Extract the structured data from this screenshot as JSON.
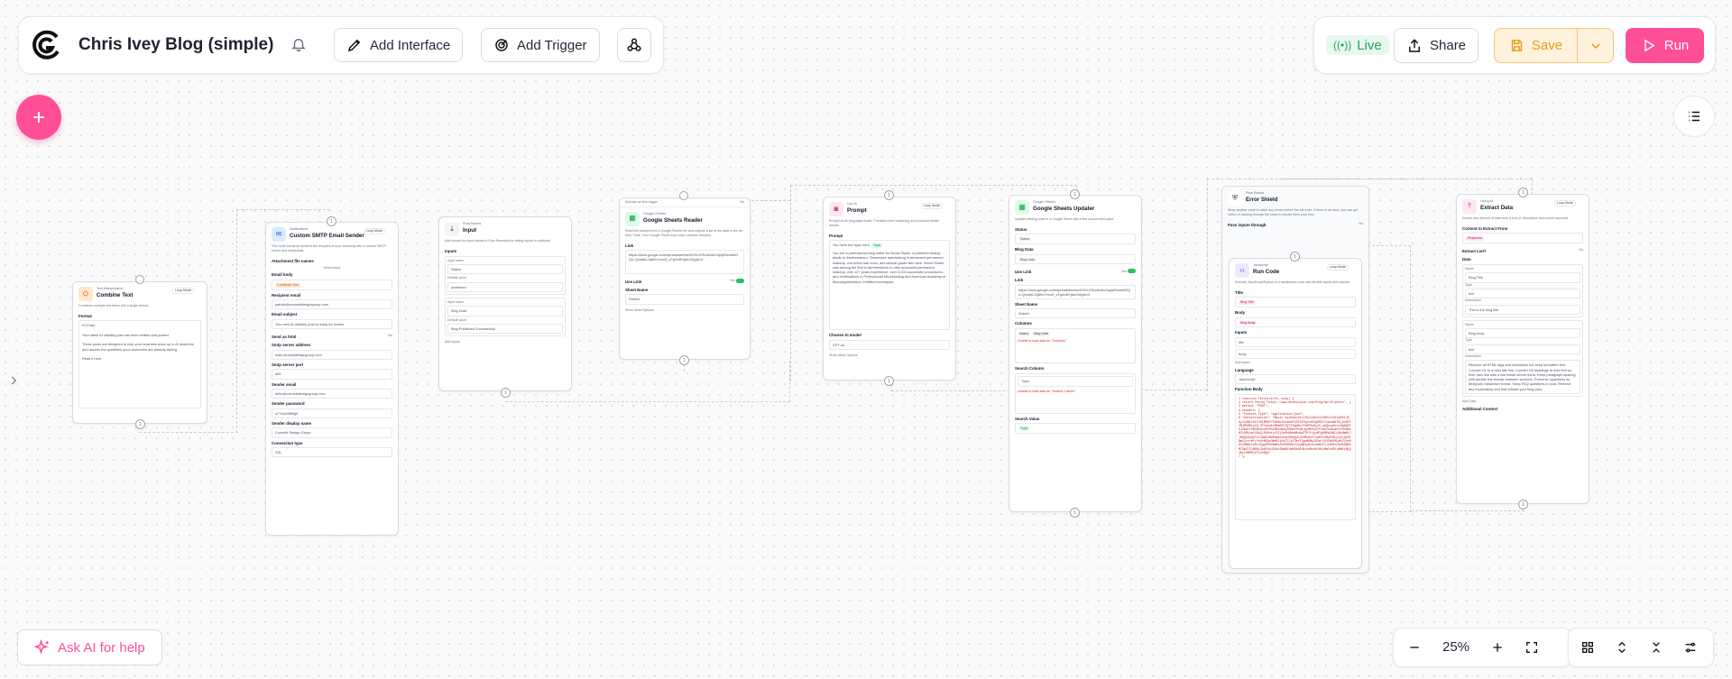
{
  "topbar": {
    "title": "Chris Ivey Blog (simple)",
    "add_interface": "Add Interface",
    "add_trigger": "Add Trigger",
    "live": "Live",
    "share": "Share",
    "save": "Save",
    "run": "Run"
  },
  "bottom": {
    "ask_ai": "Ask AI for help",
    "zoom": "25%"
  },
  "colors": {
    "accent": "#ff4f96",
    "save_bg": "#fff2dc",
    "save_text": "#e59b14",
    "live_green": "#22c55e"
  },
  "nodes": {
    "combine": {
      "category": "Text Manipulation",
      "mode": "Loop Mode",
      "title": "Combine Text",
      "desc": "Combines multiple text items into a single format",
      "format_label": "Format",
      "format_value": "Hi Chris,\n\nYour latest AI visibility post has been written and posted.\n\nThese posts are designed to help your business show up in AI searches and answer the questions your customers are already asking.\n\nRead it here:"
    },
    "smtp": {
      "category": "Notifications",
      "mode": "Loop Mode",
      "title": "Custom SMTP Email Sender",
      "desc": "This node sends an email to the recipient of your choosing with a custom SMTP server and credentials.",
      "attachment_label": "Attachment file names",
      "select_input": "Select input",
      "email_body_label": "Email body",
      "email_body_tag": "Combined Text",
      "recipient_label": "Recipient email",
      "recipient_value": "patrick@connektdesigngroup.com",
      "subject_label": "Email subject",
      "subject_value": "Your new AI visibility post is ready for review",
      "send_html_label": "Send as html",
      "send_html_value": "No",
      "server_label": "Smtp server address",
      "server_value": "mail.connektdesigngroup.com",
      "port_label": "Smtp server port",
      "port_value": "465",
      "sender_email_label": "Sender email",
      "sender_email_value": "hello@connektdesigngroup.com",
      "password_label": "Sender password",
      "password_value": "w7Yvub9f9f#j8",
      "display_label": "Sender display name",
      "display_value": "Connekt Design Group",
      "conn_label": "Connection type",
      "conn_value": "SSL"
    },
    "input": {
      "category": "Flow Basics",
      "title": "Input",
      "desc": "Add a point for input values in Flow Essential for taking inputs to subflows.",
      "inputs_label": "Inputs",
      "name1_label": "Input name",
      "name1_value": "Status",
      "def1_label": "Default value",
      "def1_value": "published",
      "name2_label": "Input name",
      "name2_value": "Blog Data",
      "def2_label": "Default value",
      "def2_value": "Blog Published Successfully",
      "add_inputs": "Add inputs"
    },
    "sheets_reader": {
      "trigger": "Activate as flow trigger",
      "trigger_value": "No",
      "category": "Google Sheets",
      "title": "Google Sheets Reader",
      "desc": "Read the content from a Google Sheets file and outputs a list of the data in the list form. Note: Your Google Sheet must have columns headers.",
      "link_label": "Link",
      "link_value": "https://docs.google.com/spreadsheets/d/1ShJr7bcdbUicXqzjdSemiefOQu-Q4ubbLZqiWvYvxoD_zTg/edit?gid=0#gid=0",
      "use_link_label": "Use Link",
      "use_link_value": "Yes",
      "sheet_label": "Sheet Name",
      "sheet_value": "Sheet1",
      "more_options": "Show More Options"
    },
    "prompt": {
      "category": "Use AI",
      "mode": "Loop Mode",
      "title": "Prompt",
      "desc": "Prompt an AI language model. Provides more reasoning and produces better results.",
      "prompt_label": "Prompt",
      "prompt_intro": "You have the topic here:",
      "topic_tag": "Topic",
      "prompt_value": "You are a professional blog writer for Mood Studio, a premium beauty studio in Murfreesboro, Tennessee specializing in advanced permanent makeup, corrective hair color, and clinical-grade skin care. Mood Studio was among the first in Murfreesboro to offer advanced permanent makeup, with 12+ years experience, over 3,000 successful procedures, and certifications in Professional Microblading and American Academy of Micropigmentation Certified techniques.",
      "model_label": "Choose AI model",
      "model_value": "GPT-4o",
      "more_options": "Show More Options"
    },
    "sheets_updater": {
      "category": "Google Sheets",
      "title": "Google Sheets Updater",
      "desc": "Update existing rows in a Google Sheet with a few column and value.",
      "status_label": "Status",
      "status_tag": "Status",
      "blog_data_label": "Blog Data",
      "blog_data_tag": "Blog Data",
      "use_link_label": "Use Link",
      "use_link_value": "Yes",
      "link_label": "Link",
      "link_value": "https://docs.google.com/spreadsheets/d/1ShJr7bcdbUicXqzjdSemiefOQu-Q4ubbLZqiWvYvxoD_zTg/edit?gid=0#gid=0",
      "sheet_label": "Sheet Name",
      "sheet_value": "Sheet1",
      "columns_label": "Columns",
      "columns_tags": [
        "Status",
        "Blog Data"
      ],
      "warning": "Unable to load data for \"Columns\"",
      "search_label": "Search Column",
      "search_value": "Topic",
      "search_warning": "Unable to load data for \"Search Column\"",
      "search_value_label": "Search Value",
      "search_value_tag": "Topic"
    },
    "error_shield": {
      "category": "Flow Basics",
      "title": "Error Shield",
      "desc": "Wrap another node to catch any errors before the full node. If there is an error, you can get notice of causing through the route to handle them your flow.",
      "pass_label": "Pass inputs through",
      "pass_value": "No"
    },
    "run_code": {
      "category": "Javascript",
      "mode": "Loop Mode",
      "title": "Run Code",
      "desc": "Execute JavaScript/Python in a sandboxed code with flexible inputs and outputs.",
      "title_label": "Title",
      "title_tag": "Blog Title",
      "body_label": "Body",
      "body_tag": "Blog Body",
      "inputs_label": "Inputs",
      "input1": "title",
      "input2": "body",
      "add_inputs": "Add inputs",
      "lang_label": "Language",
      "lang_value": "JavaScript",
      "fn_label": "Function Body",
      "code": "1 function Fetch(title, body) {\n2 return fetch('https://www.moodstudio.com/blog/wp/v2/posts', {\n3 method: \"POST\",\n4 headers: {\n5 \"Content-Type\": \"application/json\",\n6 \"Authorization\": \"Basic eyJhbGciOiJIUzI1NiIsInR5cCI6IkpXVCJ9.eyJzdWIiOiIxMjM0NTY3ODkwIiwibmFtZSI6IkpvaG4gRG9lIiwiaWF0IjoxNTE2MjM5MDIyfQ.SflKxwRJSMeKKF2QT4fwpMeJf36POk6yJV_adQssw5c1x8QbQHT8JZmUCY3ROZmUxyNTNhZDBlNmRjZGNhOTFmNjQzMDVkZTFkOGY2ZWJmYzY0YmRkNTk3MjcwYjEwZjU0ZmYyY2ZjZmFhNWVmMzAwZTRlYjkyMTg0MDdiNGJjNzNmMjJlNGQ5N2Q2YzI3NGE2MmRhNmJhNjE5MzQwZjE0MzAxZTcwNTk2MzE0Njc2ZjQ1NTBmZjcxYmFjYmUzMDQzOWM2ZjBiZTJiOTMzYTgwMGMyZGZmYjU3ZWU5NjM1ZjhhNGIyMWNjYzRlZDgyNTM2NmRiZmI0ODRkZTkyMWIyNzIxZmM4YjliMGE1YmU0ZWE3MTZmZTZjMDBjZmNlMzU3ZmY2NmRiYmM2NzRiNjk0NzdhYWViMmYxNDYyNWEzNjQ1NzI0MGE2ZTk4ODQ4\"\n7 },"
    },
    "extract": {
      "category": "Using AI",
      "mode": "Loop Mode",
      "title": "Extract Data",
      "desc": "Extract any amount of data from a text of information from some input text.",
      "content_label": "Content to Extract From",
      "content_tag": "Response",
      "list_label": "Extract List?",
      "list_value": "No",
      "data_label": "Data",
      "f1_name_label": "Name",
      "f1_name": "Blog Title",
      "f1_type_label": "Type",
      "f1_type": "text",
      "f1_desc_label": "Description",
      "f1_desc": "This is the blog title",
      "f2_name_label": "Name",
      "f2_name": "Blog body",
      "f2_type_label": "Type",
      "f2_type": "text",
      "f2_desc_label": "Description",
      "f2_desc": "Remove all HTML tags and markdown but keep formatted text. Convert H1 to a bold title line. Convert H2 headings to bold text on their own line with a line break before them. Keep paragraph spacing with double line breaks between sections. Preserve hyperlinks as [text](url) markdown format. Keep FAQ questions in bold. Remove any explanatory text that follows your blog post.",
      "add_data": "Add Data",
      "additional_label": "Additional Context"
    }
  }
}
